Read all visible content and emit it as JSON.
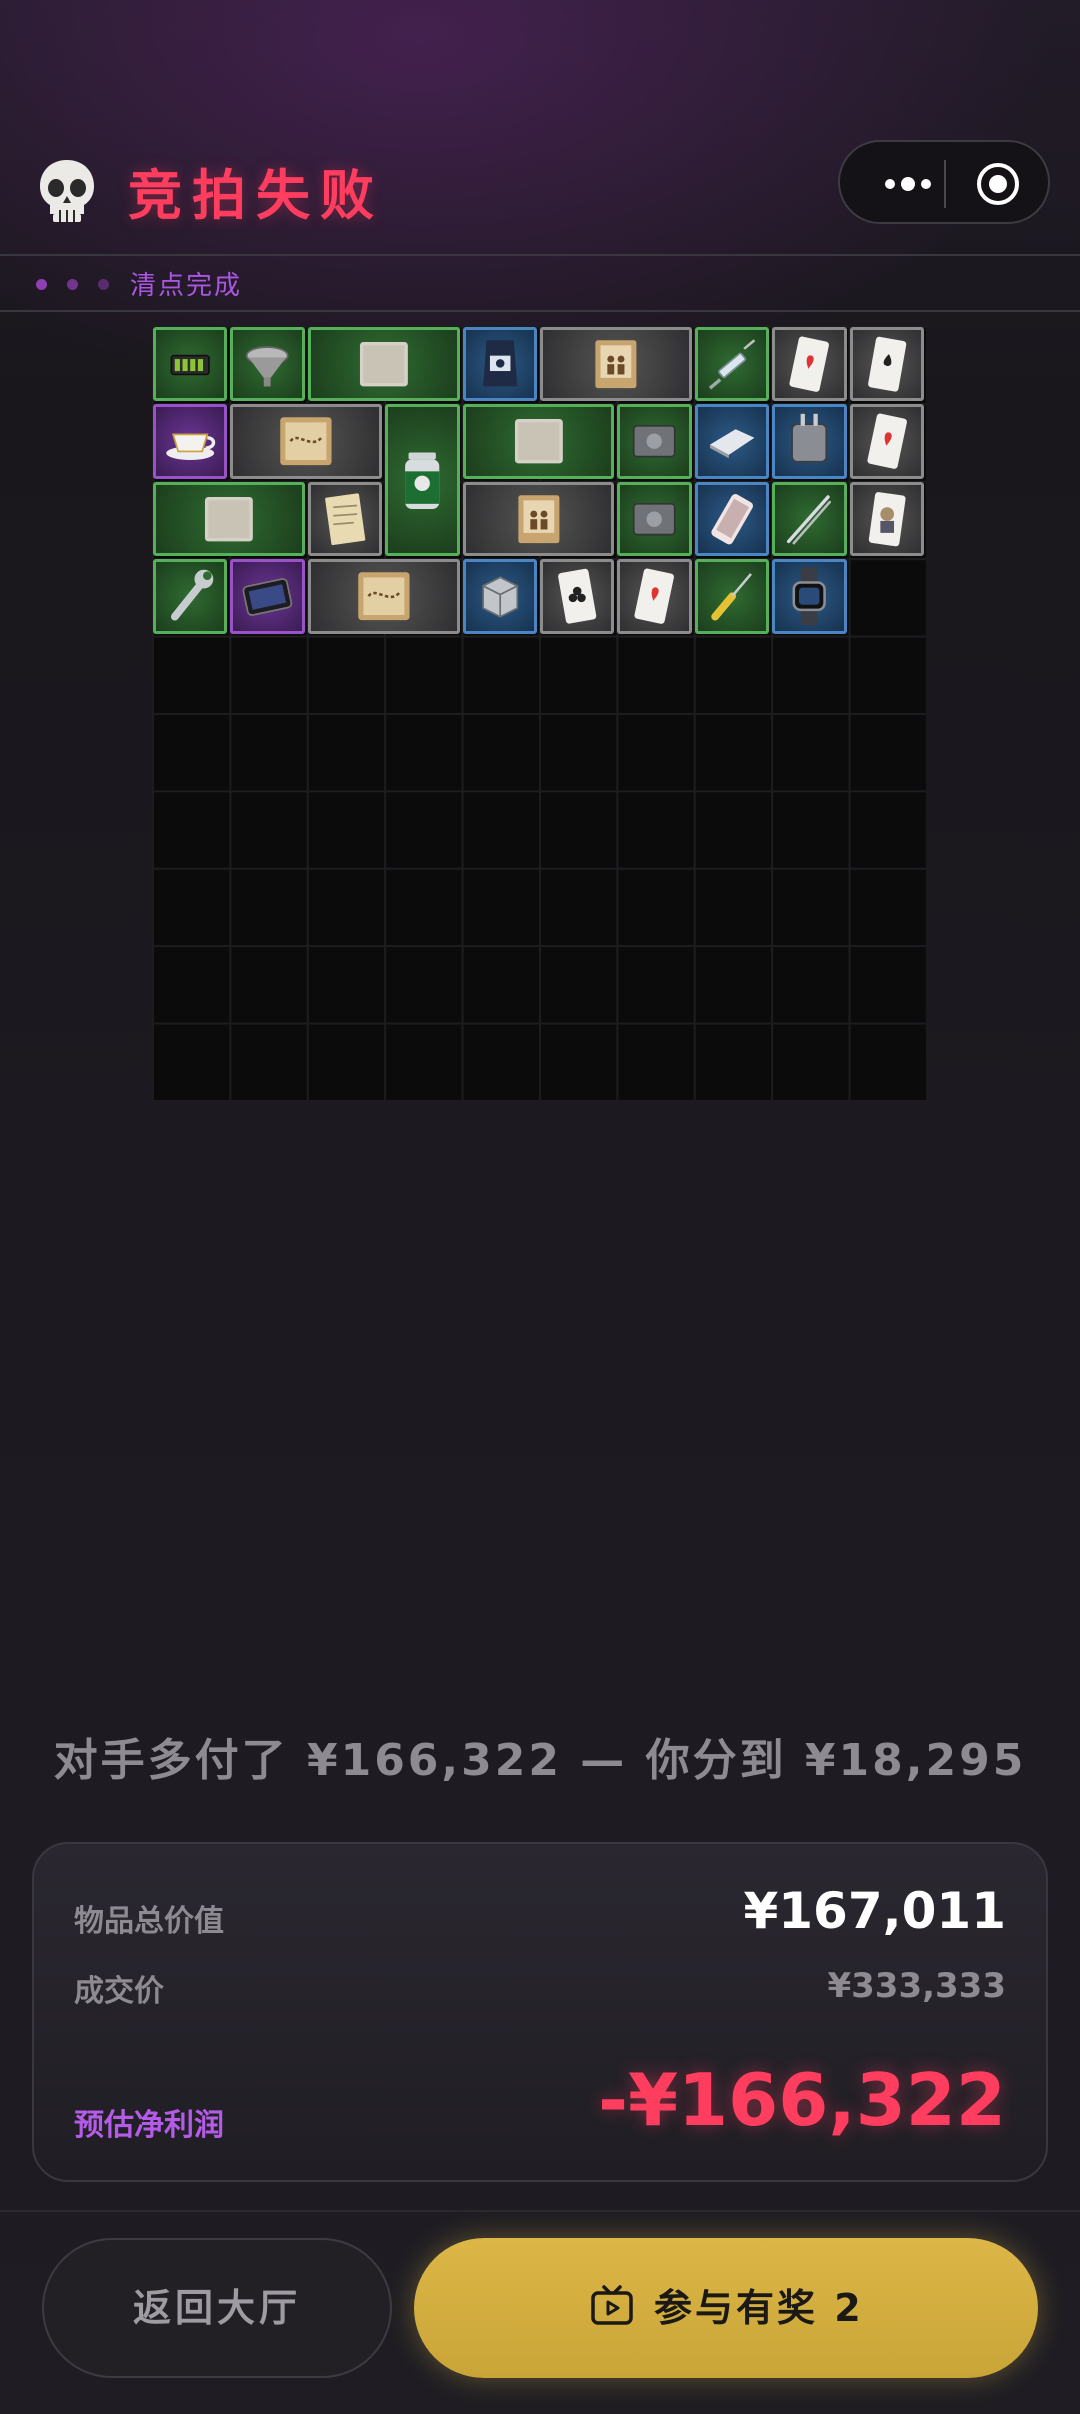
{
  "header": {
    "icon": "skull-icon",
    "title": "竞拍失败",
    "capsule": {
      "more_icon": "more-dots-icon",
      "target_icon": "target-icon"
    }
  },
  "status": {
    "text": "清点完成",
    "step_dots": 3
  },
  "colors": {
    "title_red": "#ff3d5e",
    "accent_purple": "#b45ce8",
    "button_gold": "#dcb748",
    "rarity_green": "#56b05a",
    "rarity_gray": "#8c8c8c",
    "rarity_blue": "#4a86c4",
    "rarity_purple": "#9a52c8"
  },
  "grid": {
    "columns": 10,
    "rows": 10,
    "items": [
      {
        "name": "battery-pack",
        "rarity": "green",
        "col": 0,
        "row": 0,
        "w": 1,
        "h": 1
      },
      {
        "name": "metal-funnel",
        "rarity": "green",
        "col": 1,
        "row": 0,
        "w": 1,
        "h": 1
      },
      {
        "name": "old-parchment",
        "rarity": "green",
        "col": 2,
        "row": 0,
        "w": 2,
        "h": 1
      },
      {
        "name": "coffee-bag",
        "rarity": "blue",
        "col": 4,
        "row": 0,
        "w": 1,
        "h": 1
      },
      {
        "name": "sepia-photo",
        "rarity": "gray",
        "col": 5,
        "row": 0,
        "w": 2,
        "h": 1
      },
      {
        "name": "syringe",
        "rarity": "green",
        "col": 7,
        "row": 0,
        "w": 1,
        "h": 1
      },
      {
        "name": "playing-card-hearts",
        "rarity": "gray",
        "col": 8,
        "row": 0,
        "w": 1,
        "h": 1
      },
      {
        "name": "playing-card-spades",
        "rarity": "gray",
        "col": 9,
        "row": 0,
        "w": 1,
        "h": 1
      },
      {
        "name": "teacup",
        "rarity": "purple",
        "col": 0,
        "row": 1,
        "w": 1,
        "h": 1
      },
      {
        "name": "treasure-map",
        "rarity": "gray",
        "col": 1,
        "row": 1,
        "w": 2,
        "h": 1
      },
      {
        "name": "spray-can",
        "rarity": "green",
        "col": 3,
        "row": 1,
        "w": 1,
        "h": 2
      },
      {
        "name": "old-parchment",
        "rarity": "green",
        "col": 4,
        "row": 1,
        "w": 2,
        "h": 1
      },
      {
        "name": "hard-drive",
        "rarity": "green",
        "col": 6,
        "row": 1,
        "w": 1,
        "h": 1
      },
      {
        "name": "metal-plate",
        "rarity": "blue",
        "col": 7,
        "row": 1,
        "w": 1,
        "h": 1
      },
      {
        "name": "power-adapter",
        "rarity": "blue",
        "col": 8,
        "row": 1,
        "w": 1,
        "h": 1
      },
      {
        "name": "playing-card-hearts",
        "rarity": "gray",
        "col": 9,
        "row": 1,
        "w": 1,
        "h": 1
      },
      {
        "name": "old-parchment",
        "rarity": "green",
        "col": 0,
        "row": 2,
        "w": 2,
        "h": 1
      },
      {
        "name": "note-paper",
        "rarity": "gray",
        "col": 2,
        "row": 2,
        "w": 1,
        "h": 1
      },
      {
        "name": "sepia-photo",
        "rarity": "gray",
        "col": 4,
        "row": 2,
        "w": 2,
        "h": 1
      },
      {
        "name": "hard-drive",
        "rarity": "green",
        "col": 6,
        "row": 2,
        "w": 1,
        "h": 1
      },
      {
        "name": "smartphone",
        "rarity": "blue",
        "col": 7,
        "row": 2,
        "w": 1,
        "h": 1
      },
      {
        "name": "tweezers",
        "rarity": "green",
        "col": 8,
        "row": 2,
        "w": 1,
        "h": 1
      },
      {
        "name": "playing-card-face",
        "rarity": "gray",
        "col": 9,
        "row": 2,
        "w": 1,
        "h": 1
      },
      {
        "name": "wrench",
        "rarity": "green",
        "col": 0,
        "row": 3,
        "w": 1,
        "h": 1
      },
      {
        "name": "tablet",
        "rarity": "purple",
        "col": 1,
        "row": 3,
        "w": 1,
        "h": 1
      },
      {
        "name": "treasure-map",
        "rarity": "gray",
        "col": 2,
        "row": 3,
        "w": 2,
        "h": 1
      },
      {
        "name": "metal-cube",
        "rarity": "blue",
        "col": 4,
        "row": 3,
        "w": 1,
        "h": 1
      },
      {
        "name": "playing-card-clubs",
        "rarity": "gray",
        "col": 5,
        "row": 3,
        "w": 1,
        "h": 1
      },
      {
        "name": "playing-card-hearts",
        "rarity": "gray",
        "col": 6,
        "row": 3,
        "w": 1,
        "h": 1
      },
      {
        "name": "screwdriver",
        "rarity": "green",
        "col": 7,
        "row": 3,
        "w": 1,
        "h": 1
      },
      {
        "name": "smartwatch",
        "rarity": "blue",
        "col": 8,
        "row": 3,
        "w": 1,
        "h": 1
      }
    ]
  },
  "result": {
    "summary": "对手多付了 ¥166,322 — 你分到 ¥18,295",
    "total_value_label": "物品总价值",
    "total_value": "¥167,011",
    "deal_price_label": "成交价",
    "deal_price": "¥333,333",
    "profit_label": "预估净利润",
    "profit": "-¥166,322"
  },
  "actions": {
    "back_label": "返回大厅",
    "join_label": "参与有奖 2",
    "join_icon": "tv-icon"
  }
}
